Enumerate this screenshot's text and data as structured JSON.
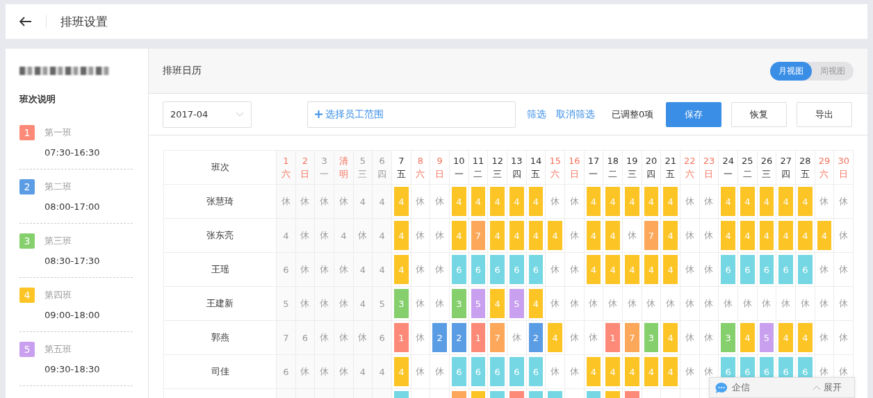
{
  "header": {
    "title": "排班设置"
  },
  "sidebar": {
    "section_title": "班次说明",
    "shifts": [
      {
        "number": "1",
        "name": "第一班",
        "time": "07:30-16:30",
        "color": "#fd8a78"
      },
      {
        "number": "2",
        "name": "第二班",
        "time": "08:00-17:00",
        "color": "#5b9de4"
      },
      {
        "number": "3",
        "name": "第三班",
        "time": "08:30-17:30",
        "color": "#85cf6c"
      },
      {
        "number": "4",
        "name": "第四班",
        "time": "09:00-18:00",
        "color": "#fcc425"
      },
      {
        "number": "5",
        "name": "第五班",
        "time": "09:30-18:30",
        "color": "#c9a0ef"
      }
    ]
  },
  "calendar": {
    "title": "排班日历",
    "view_tabs": [
      {
        "label": "月视图",
        "selected": true
      },
      {
        "label": "周视图",
        "selected": false
      }
    ],
    "month": "2017-04",
    "employee_picker": {
      "placeholder": "选择员工范围"
    },
    "links": [
      "筛选",
      "取消筛选"
    ],
    "adjusted": "已调整0项",
    "buttons": [
      {
        "label": "保存",
        "kind": "primary"
      },
      {
        "label": "恢复",
        "kind": "default"
      },
      {
        "label": "导出",
        "kind": "default"
      }
    ],
    "table": {
      "name_heading": "班次",
      "days": [
        {
          "day": "1",
          "weekday": "六",
          "past": true,
          "holiday": true
        },
        {
          "day": "2",
          "weekday": "日",
          "past": true,
          "holiday": true
        },
        {
          "day": "3",
          "weekday": "一",
          "past": true,
          "holiday": false
        },
        {
          "day": "清",
          "weekday": "明",
          "past": true,
          "holiday": true
        },
        {
          "day": "5",
          "weekday": "三",
          "past": true,
          "holiday": false
        },
        {
          "day": "6",
          "weekday": "四",
          "past": true,
          "holiday": false
        },
        {
          "day": "7",
          "weekday": "五",
          "past": false,
          "holiday": false
        },
        {
          "day": "8",
          "weekday": "六",
          "past": false,
          "holiday": true
        },
        {
          "day": "9",
          "weekday": "日",
          "past": false,
          "holiday": true
        },
        {
          "day": "10",
          "weekday": "一",
          "past": false,
          "holiday": false
        },
        {
          "day": "11",
          "weekday": "二",
          "past": false,
          "holiday": false
        },
        {
          "day": "12",
          "weekday": "三",
          "past": false,
          "holiday": false
        },
        {
          "day": "13",
          "weekday": "四",
          "past": false,
          "holiday": false
        },
        {
          "day": "14",
          "weekday": "五",
          "past": false,
          "holiday": false
        },
        {
          "day": "15",
          "weekday": "六",
          "past": false,
          "holiday": true
        },
        {
          "day": "16",
          "weekday": "日",
          "past": false,
          "holiday": true
        },
        {
          "day": "17",
          "weekday": "一",
          "past": false,
          "holiday": false
        },
        {
          "day": "18",
          "weekday": "二",
          "past": false,
          "holiday": false
        },
        {
          "day": "19",
          "weekday": "三",
          "past": false,
          "holiday": false
        },
        {
          "day": "20",
          "weekday": "四",
          "past": false,
          "holiday": false
        },
        {
          "day": "21",
          "weekday": "五",
          "past": false,
          "holiday": false
        },
        {
          "day": "22",
          "weekday": "六",
          "past": false,
          "holiday": true
        },
        {
          "day": "23",
          "weekday": "日",
          "past": false,
          "holiday": true
        },
        {
          "day": "24",
          "weekday": "一",
          "past": false,
          "holiday": false
        },
        {
          "day": "25",
          "weekday": "二",
          "past": false,
          "holiday": false
        },
        {
          "day": "26",
          "weekday": "三",
          "past": false,
          "holiday": false
        },
        {
          "day": "27",
          "weekday": "四",
          "past": false,
          "holiday": false
        },
        {
          "day": "28",
          "weekday": "五",
          "past": false,
          "holiday": false
        },
        {
          "day": "29",
          "weekday": "六",
          "past": false,
          "holiday": true
        },
        {
          "day": "30",
          "weekday": "日",
          "past": false,
          "holiday": true
        }
      ],
      "rows": [
        {
          "name": "张慧琦",
          "cells": [
            {
              "text": "休"
            },
            {
              "text": "休"
            },
            {
              "text": "休"
            },
            {
              "text": "休"
            },
            {
              "text": "4"
            },
            {
              "text": "4"
            },
            {
              "text": "4",
              "color": "#fcc425"
            },
            {
              "text": "休"
            },
            {
              "text": "休"
            },
            {
              "text": "4",
              "color": "#fcc425"
            },
            {
              "text": "4",
              "color": "#fcc425"
            },
            {
              "text": "4",
              "color": "#fcc425"
            },
            {
              "text": "4",
              "color": "#fcc425"
            },
            {
              "text": "4",
              "color": "#fcc425"
            },
            {
              "text": "休"
            },
            {
              "text": "休"
            },
            {
              "text": "4",
              "color": "#fcc425"
            },
            {
              "text": "4",
              "color": "#fcc425"
            },
            {
              "text": "4",
              "color": "#fcc425"
            },
            {
              "text": "4",
              "color": "#fcc425"
            },
            {
              "text": "4",
              "color": "#fcc425"
            },
            {
              "text": "休"
            },
            {
              "text": "休"
            },
            {
              "text": "4",
              "color": "#fcc425"
            },
            {
              "text": "4",
              "color": "#fcc425"
            },
            {
              "text": "4",
              "color": "#fcc425"
            },
            {
              "text": "4",
              "color": "#fcc425"
            },
            {
              "text": "4",
              "color": "#fcc425"
            },
            {
              "text": "休"
            },
            {
              "text": "休"
            }
          ]
        },
        {
          "name": "张东亮",
          "cells": [
            {
              "text": "4"
            },
            {
              "text": "休"
            },
            {
              "text": "休"
            },
            {
              "text": "4"
            },
            {
              "text": "休"
            },
            {
              "text": "4"
            },
            {
              "text": "4",
              "color": "#fcc425"
            },
            {
              "text": "休"
            },
            {
              "text": "休"
            },
            {
              "text": "4",
              "color": "#fcc425"
            },
            {
              "text": "7",
              "color": "#fca75a"
            },
            {
              "text": "4",
              "color": "#fcc425"
            },
            {
              "text": "4",
              "color": "#fcc425"
            },
            {
              "text": "4",
              "color": "#fcc425"
            },
            {
              "text": "4",
              "color": "#fcc425"
            },
            {
              "text": "休"
            },
            {
              "text": "4",
              "color": "#fcc425"
            },
            {
              "text": "4",
              "color": "#fcc425"
            },
            {
              "text": "休"
            },
            {
              "text": "7",
              "color": "#fca75a"
            },
            {
              "text": "4",
              "color": "#fcc425"
            },
            {
              "text": "休"
            },
            {
              "text": "休"
            },
            {
              "text": "4",
              "color": "#fcc425"
            },
            {
              "text": "4",
              "color": "#fcc425"
            },
            {
              "text": "4",
              "color": "#fcc425"
            },
            {
              "text": "4",
              "color": "#fcc425"
            },
            {
              "text": "4",
              "color": "#fcc425"
            },
            {
              "text": "4",
              "color": "#fcc425"
            },
            {
              "text": "休"
            }
          ]
        },
        {
          "name": "王瑶",
          "cells": [
            {
              "text": "6"
            },
            {
              "text": "休"
            },
            {
              "text": "休"
            },
            {
              "text": "休"
            },
            {
              "text": "4"
            },
            {
              "text": "4"
            },
            {
              "text": "4",
              "color": "#fcc425"
            },
            {
              "text": "休"
            },
            {
              "text": "休"
            },
            {
              "text": "6",
              "color": "#74d7e3"
            },
            {
              "text": "6",
              "color": "#74d7e3"
            },
            {
              "text": "6",
              "color": "#74d7e3"
            },
            {
              "text": "6",
              "color": "#74d7e3"
            },
            {
              "text": "6",
              "color": "#74d7e3"
            },
            {
              "text": "休"
            },
            {
              "text": "休"
            },
            {
              "text": "4",
              "color": "#fcc425"
            },
            {
              "text": "4",
              "color": "#fcc425"
            },
            {
              "text": "4",
              "color": "#fcc425"
            },
            {
              "text": "4",
              "color": "#fcc425"
            },
            {
              "text": "4",
              "color": "#fcc425"
            },
            {
              "text": "休"
            },
            {
              "text": "休"
            },
            {
              "text": "6",
              "color": "#74d7e3"
            },
            {
              "text": "6",
              "color": "#74d7e3"
            },
            {
              "text": "6",
              "color": "#74d7e3"
            },
            {
              "text": "6",
              "color": "#74d7e3"
            },
            {
              "text": "6",
              "color": "#74d7e3"
            },
            {
              "text": "休"
            },
            {
              "text": "休"
            }
          ]
        },
        {
          "name": "王建新",
          "cells": [
            {
              "text": "5"
            },
            {
              "text": "休"
            },
            {
              "text": "休"
            },
            {
              "text": "休"
            },
            {
              "text": "4"
            },
            {
              "text": "5"
            },
            {
              "text": "3",
              "color": "#85cf6c"
            },
            {
              "text": "休"
            },
            {
              "text": "休"
            },
            {
              "text": "3",
              "color": "#85cf6c"
            },
            {
              "text": "5",
              "color": "#c9a0ef"
            },
            {
              "text": "4",
              "color": "#fcc425"
            },
            {
              "text": "5",
              "color": "#c9a0ef"
            },
            {
              "text": "4",
              "color": "#fcc425"
            },
            {
              "text": "休"
            },
            {
              "text": "休"
            },
            {
              "text": "休"
            },
            {
              "text": "休"
            },
            {
              "text": "休"
            },
            {
              "text": "休"
            },
            {
              "text": "休"
            },
            {
              "text": "休"
            },
            {
              "text": "休"
            },
            {
              "text": "休"
            },
            {
              "text": "休"
            },
            {
              "text": "休"
            },
            {
              "text": "休"
            },
            {
              "text": "休"
            },
            {
              "text": "休"
            },
            {
              "text": "休"
            }
          ]
        },
        {
          "name": "郭燕",
          "cells": [
            {
              "text": "7"
            },
            {
              "text": "6"
            },
            {
              "text": "休"
            },
            {
              "text": "休"
            },
            {
              "text": "休"
            },
            {
              "text": "6"
            },
            {
              "text": "1",
              "color": "#fd8a78"
            },
            {
              "text": "休"
            },
            {
              "text": "2",
              "color": "#5b9de4"
            },
            {
              "text": "2",
              "color": "#5b9de4"
            },
            {
              "text": "1",
              "color": "#fd8a78"
            },
            {
              "text": "7",
              "color": "#fca75a"
            },
            {
              "text": "休"
            },
            {
              "text": "2",
              "color": "#5b9de4"
            },
            {
              "text": "4",
              "color": "#fcc425"
            },
            {
              "text": "休"
            },
            {
              "text": "休"
            },
            {
              "text": "1",
              "color": "#fd8a78"
            },
            {
              "text": "7",
              "color": "#fca75a"
            },
            {
              "text": "3",
              "color": "#85cf6c"
            },
            {
              "text": "4",
              "color": "#fcc425"
            },
            {
              "text": "休"
            },
            {
              "text": "休"
            },
            {
              "text": "3",
              "color": "#85cf6c"
            },
            {
              "text": "4",
              "color": "#fcc425"
            },
            {
              "text": "5",
              "color": "#c9a0ef"
            },
            {
              "text": "4",
              "color": "#fcc425"
            },
            {
              "text": "4",
              "color": "#fcc425"
            },
            {
              "text": "休"
            },
            {
              "text": "休"
            }
          ]
        },
        {
          "name": "司佳",
          "cells": [
            {
              "text": "6"
            },
            {
              "text": "休"
            },
            {
              "text": "休"
            },
            {
              "text": "休"
            },
            {
              "text": "4"
            },
            {
              "text": "4"
            },
            {
              "text": "4",
              "color": "#fcc425"
            },
            {
              "text": "休"
            },
            {
              "text": "休"
            },
            {
              "text": "6",
              "color": "#74d7e3"
            },
            {
              "text": "6",
              "color": "#74d7e3"
            },
            {
              "text": "6",
              "color": "#74d7e3"
            },
            {
              "text": "6",
              "color": "#74d7e3"
            },
            {
              "text": "6",
              "color": "#74d7e3"
            },
            {
              "text": "休"
            },
            {
              "text": "休"
            },
            {
              "text": "4",
              "color": "#fcc425"
            },
            {
              "text": "4",
              "color": "#fcc425"
            },
            {
              "text": "4",
              "color": "#fcc425"
            },
            {
              "text": "4",
              "color": "#fcc425"
            },
            {
              "text": "4",
              "color": "#fcc425"
            },
            {
              "text": "休"
            },
            {
              "text": "休"
            },
            {
              "text": "6",
              "color": "#74d7e3"
            },
            {
              "text": "6",
              "color": "#74d7e3"
            },
            {
              "text": "6",
              "color": "#74d7e3"
            },
            {
              "text": "6",
              "color": "#74d7e3"
            },
            {
              "text": "6",
              "color": "#74d7e3"
            },
            {
              "text": "休"
            },
            {
              "text": "休"
            }
          ]
        },
        {
          "cells": [
            null,
            null,
            null,
            null,
            null,
            null,
            {
              "color": "#74d7e3"
            },
            null,
            null,
            {
              "color": "#fca75a"
            },
            {
              "color": "#fcc425"
            },
            {
              "color": "#74d7e3"
            },
            {
              "color": "#fd8a78"
            },
            {
              "color": "#74d7e3"
            },
            {
              "color": "#74d7e3"
            },
            null,
            {
              "color": "#74d7e3"
            },
            {
              "color": "#fcc425"
            },
            {
              "color": "#fd8a78"
            },
            null,
            null,
            null,
            null,
            null,
            null,
            null,
            null,
            null,
            null,
            null
          ]
        }
      ]
    }
  },
  "chat_widget": {
    "label": "企信",
    "toggle": "展开"
  }
}
